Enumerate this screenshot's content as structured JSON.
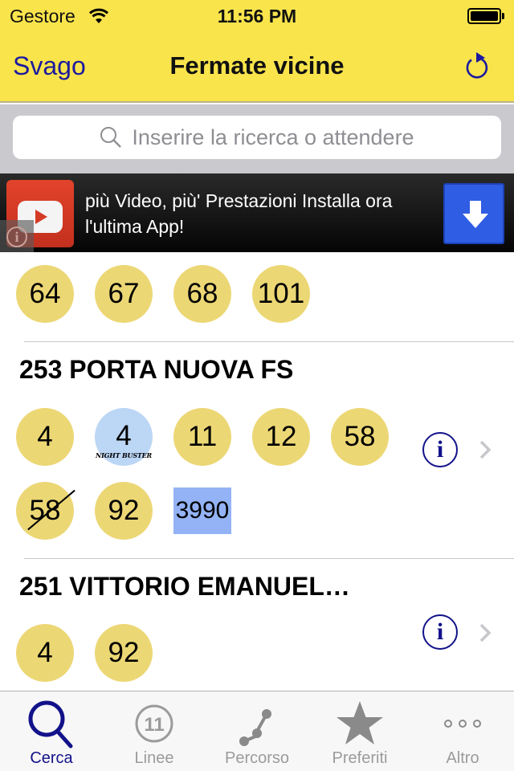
{
  "status_bar": {
    "carrier": "Gestore",
    "time": "11:56 PM"
  },
  "nav": {
    "left_button": "Svago",
    "title": "Fermate vicine",
    "right_icon": "refresh-icon"
  },
  "search": {
    "placeholder": "Inserire la ricerca o attendere"
  },
  "ad": {
    "text": "più Video, più' Prestazioni Installa ora l'ultima App!",
    "icons": [
      "youtube-logo",
      "info-icon",
      "download-icon"
    ]
  },
  "stops": [
    {
      "name": "",
      "lines": [
        {
          "label": "64",
          "style": "yellow"
        },
        {
          "label": "67",
          "style": "yellow"
        },
        {
          "label": "68",
          "style": "yellow"
        },
        {
          "label": "101",
          "style": "yellow"
        }
      ]
    },
    {
      "name": "253 PORTA NUOVA FS",
      "lines": [
        {
          "label": "4",
          "style": "yellow"
        },
        {
          "label": "4",
          "style": "night",
          "sublabel": "NIGHT BUSTER"
        },
        {
          "label": "11",
          "style": "yellow"
        },
        {
          "label": "12",
          "style": "yellow"
        },
        {
          "label": "58",
          "style": "yellow"
        },
        {
          "label": "58",
          "style": "strikethrough"
        },
        {
          "label": "92",
          "style": "yellow"
        },
        {
          "label": "3990",
          "style": "square-blue"
        }
      ]
    },
    {
      "name": "251 VITTORIO EMANUEL…",
      "lines": [
        {
          "label": "4",
          "style": "yellow"
        },
        {
          "label": "92",
          "style": "yellow"
        }
      ]
    }
  ],
  "tabs": [
    {
      "label": "Cerca",
      "icon": "search-icon",
      "active": true
    },
    {
      "label": "Linee",
      "icon": "line-number-icon",
      "icon_text": "11",
      "active": false
    },
    {
      "label": "Percorso",
      "icon": "route-icon",
      "active": false
    },
    {
      "label": "Preferiti",
      "icon": "star-icon",
      "active": false
    },
    {
      "label": "Altro",
      "icon": "more-icon",
      "active": false
    }
  ],
  "colors": {
    "header_bg": "#f9e44c",
    "accent": "#1c1a9e",
    "badge_yellow": "#ecd775",
    "badge_night": "#bcd6f5",
    "badge_square": "#93b3f6",
    "ad_button": "#2f5de3"
  }
}
